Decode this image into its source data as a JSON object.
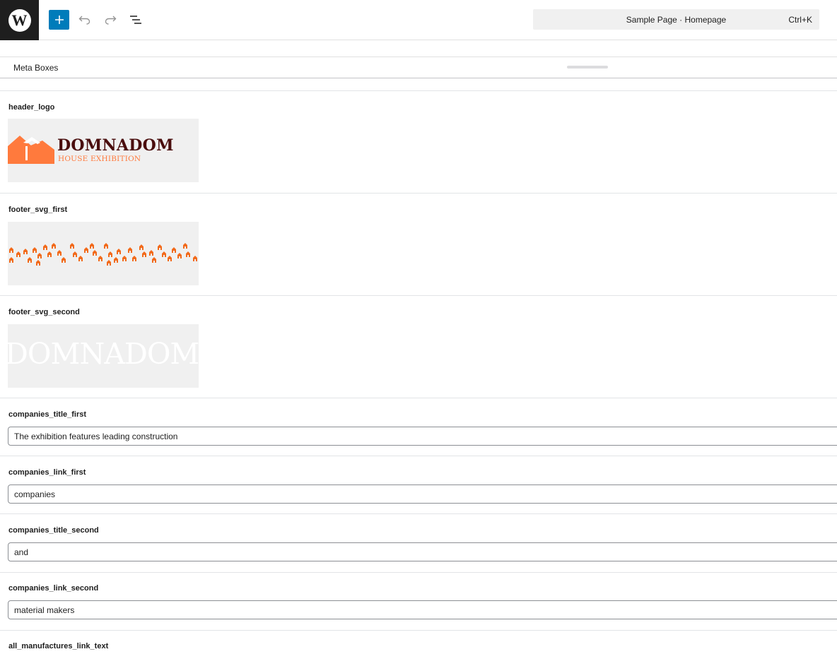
{
  "toolbar": {
    "logo_glyph": "W",
    "add_label": "+",
    "document_title": "Sample Page · Homepage",
    "shortcut": "Ctrl+K"
  },
  "meta_boxes": {
    "title": "Meta Boxes"
  },
  "fields": {
    "header_logo": {
      "label": "header_logo",
      "logo_title": "DOMNADOM",
      "logo_subtitle": "HOUSE EXHIBITION"
    },
    "footer_svg_first": {
      "label": "footer_svg_first"
    },
    "footer_svg_second": {
      "label": "footer_svg_second",
      "text": "DOMNADOM"
    },
    "companies_title_first": {
      "label": "companies_title_first",
      "value": "The exhibition features leading construction"
    },
    "companies_link_first": {
      "label": "companies_link_first",
      "value": "companies"
    },
    "companies_title_second": {
      "label": "companies_title_second",
      "value": "and"
    },
    "companies_link_second": {
      "label": "companies_link_second",
      "value": "material makers"
    },
    "all_manufactures_link_text": {
      "label": "all_manufactures_link_text"
    }
  },
  "colors": {
    "accent": "#007cba",
    "logo_orange": "#ff7a3d",
    "logo_dark": "#4a0e0e",
    "footer_orange": "#f26a1b"
  }
}
